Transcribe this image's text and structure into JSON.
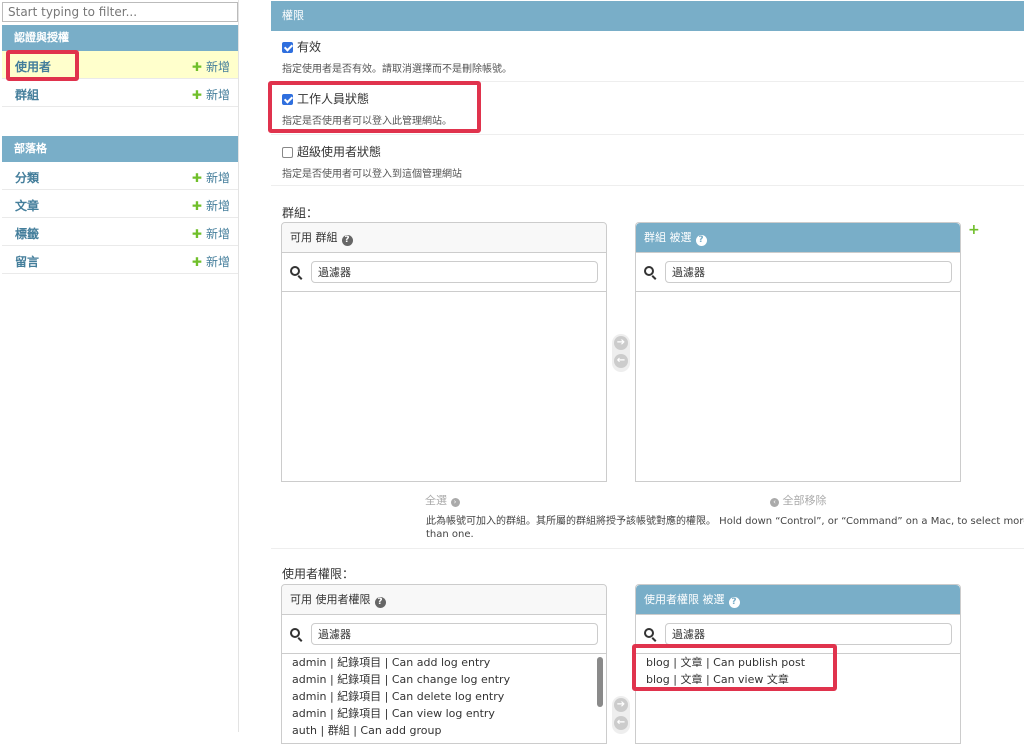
{
  "sidebar": {
    "filter_placeholder": "Start typing to filter...",
    "modules": [
      {
        "caption": "認證與授權",
        "items": [
          {
            "label": "使用者",
            "add": "新增",
            "selected": true
          },
          {
            "label": "群組",
            "add": "新增",
            "selected": false
          }
        ]
      },
      {
        "caption": "部落格",
        "items": [
          {
            "label": "分類",
            "add": "新增"
          },
          {
            "label": "文章",
            "add": "新增"
          },
          {
            "label": "標籤",
            "add": "新增"
          },
          {
            "label": "留言",
            "add": "新增"
          }
        ]
      }
    ]
  },
  "permissions": {
    "caption": "權限",
    "active": {
      "label": "有效",
      "checked": true,
      "help": "指定使用者是否有效。請取消選擇而不是刪除帳號。"
    },
    "staff": {
      "label": "工作人員狀態",
      "checked": true,
      "help": "指定是否使用者可以登入此管理網站。"
    },
    "superuser": {
      "label": "超級使用者狀態",
      "checked": false,
      "help": "指定是否使用者可以登入到這個管理網站"
    }
  },
  "groups": {
    "label": "群組：",
    "available_title": "可用 群組",
    "chosen_title": "群組 被選",
    "filter_placeholder": "過濾器",
    "choose_all": "全選",
    "remove_all": "全部移除",
    "help": "此為帳號可加入的群組。其所屬的群組將授予該帳號對應的權限。 Hold down “Control”, or “Command” on a Mac, to select more than one.",
    "help_line1": "此為帳號可加入的群組。其所屬的群組將授予該帳號對應的權限。 Hold down “Control”, or “Command” on a Mac, to select more",
    "help_line2": "than one."
  },
  "user_permissions": {
    "label": "使用者權限：",
    "available_title": "可用 使用者權限",
    "chosen_title": "使用者權限 被選",
    "filter_placeholder": "過濾器",
    "available_options": [
      "admin | 紀錄項目 | Can add log entry",
      "admin | 紀錄項目 | Can change log entry",
      "admin | 紀錄項目 | Can delete log entry",
      "admin | 紀錄項目 | Can view log entry",
      "auth | 群組 | Can add group"
    ],
    "chosen_options": [
      "blog | 文章 | Can publish post",
      "blog | 文章 | Can view 文章"
    ]
  },
  "colors": {
    "header": "#79aec8",
    "link": "#447e9b",
    "add_green": "#70bf2b",
    "highlight_box": "#e0334d",
    "selected_row": "#ffffcc"
  },
  "icons": [
    "search-icon",
    "help-icon",
    "plus-icon",
    "arrow-right-icon",
    "arrow-left-icon",
    "checkbox-icon"
  ]
}
